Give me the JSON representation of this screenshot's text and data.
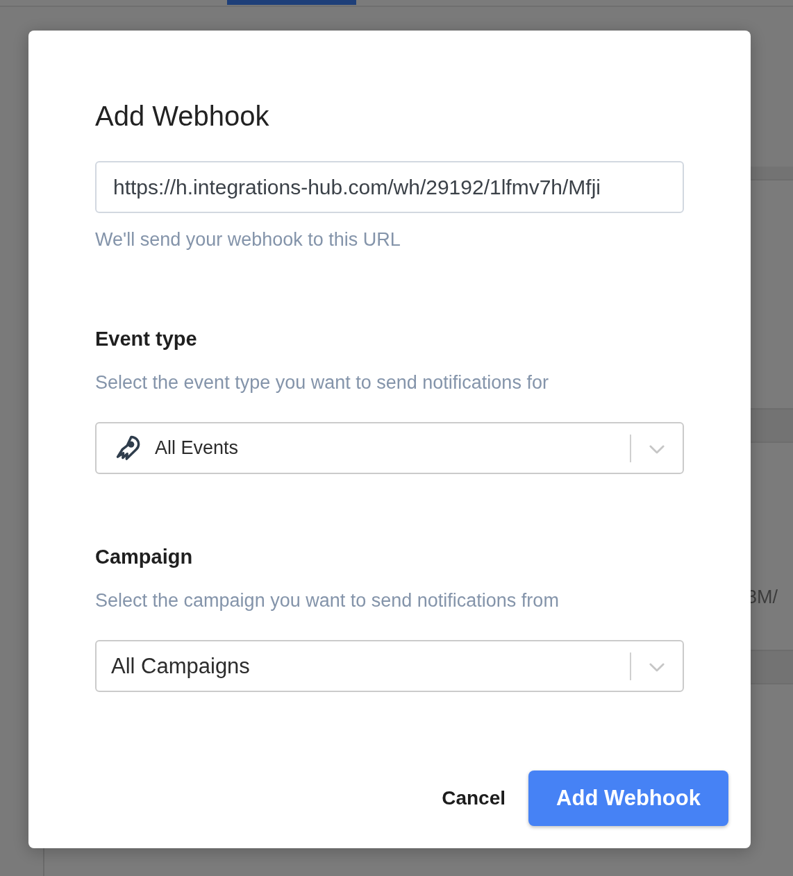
{
  "background": {
    "text": "3M/"
  },
  "modal": {
    "title": "Add Webhook",
    "url_field": {
      "value": "https://h.integrations-hub.com/wh/29192/1lfmv7h/Mfji",
      "help": "We'll send your webhook to this URL"
    },
    "sections": [
      {
        "label": "Event type",
        "description": "Select the event type you want to send notifications for",
        "select": {
          "kind": "icon",
          "value": "All Events"
        }
      },
      {
        "label": "Campaign",
        "description": "Select the campaign you want to send notifications from",
        "select": {
          "kind": "plain",
          "value": "All Campaigns"
        }
      }
    ],
    "buttons": [
      {
        "kind": "secondary",
        "label": "Cancel"
      },
      {
        "kind": "primary",
        "label": "Add Webhook"
      }
    ]
  }
}
